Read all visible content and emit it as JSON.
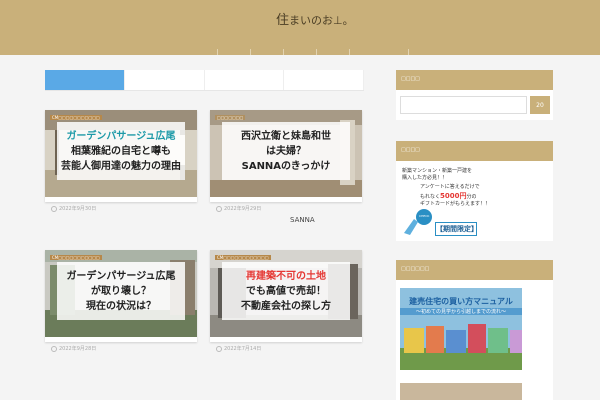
{
  "site": {
    "logo_main": "住",
    "logo_sub": "まいのお⊥。"
  },
  "tabs": [
    {
      "label": ""
    },
    {
      "label": ""
    },
    {
      "label": ""
    },
    {
      "label": ""
    }
  ],
  "cards": [
    {
      "category": "CM□□□□□□□□□□□",
      "lines": [
        "ガーデンパサージュ広尾",
        "相葉雅紀の自宅と噂も",
        "芸能人御用達の魅力の理由"
      ],
      "date": "2022年9月30日",
      "author": ""
    },
    {
      "category": "□□□□□□□",
      "lines": [
        "西沢立衛と妹島和世",
        "は夫婦？",
        "SANNAのきっかけ"
      ],
      "date": "2022年9月29日",
      "author": "SANNA"
    },
    {
      "category": "CM□□□□□□□□□□□",
      "lines": [
        "ガーデンパサージュ広尾",
        "が取り壊し？",
        "現在の状況は？"
      ],
      "date": "2022年9月28日",
      "author": ""
    },
    {
      "category": "CM□□□□□□□□□□□□",
      "lines": [
        "再建築不可の土地",
        "でも高値で売却！",
        "不動産会社の探し方"
      ],
      "date": "2022年7月14日",
      "author": ""
    }
  ],
  "sidebar": {
    "search_heading": "□□□□",
    "search_button": "20",
    "ad_heading": "□□□□",
    "ad_line1": "新築マンション・新築一戸建を",
    "ad_line2": "購入した方必見！！",
    "ad_line3": "アンケートに答えるだけで",
    "ad_line4_a": "もれなく",
    "ad_price": "5000円",
    "ad_line4_b": "分の",
    "ad_line5": "ギフトカードがもらえます！！",
    "ad_check": "CHECK",
    "ad_limited": "【期間限定】",
    "popular_heading": "□□□□□□",
    "banner_title": "建売住宅の買い方マニュアル",
    "banner_sub": "〜初めての見学から引越しまでの流れ〜"
  }
}
